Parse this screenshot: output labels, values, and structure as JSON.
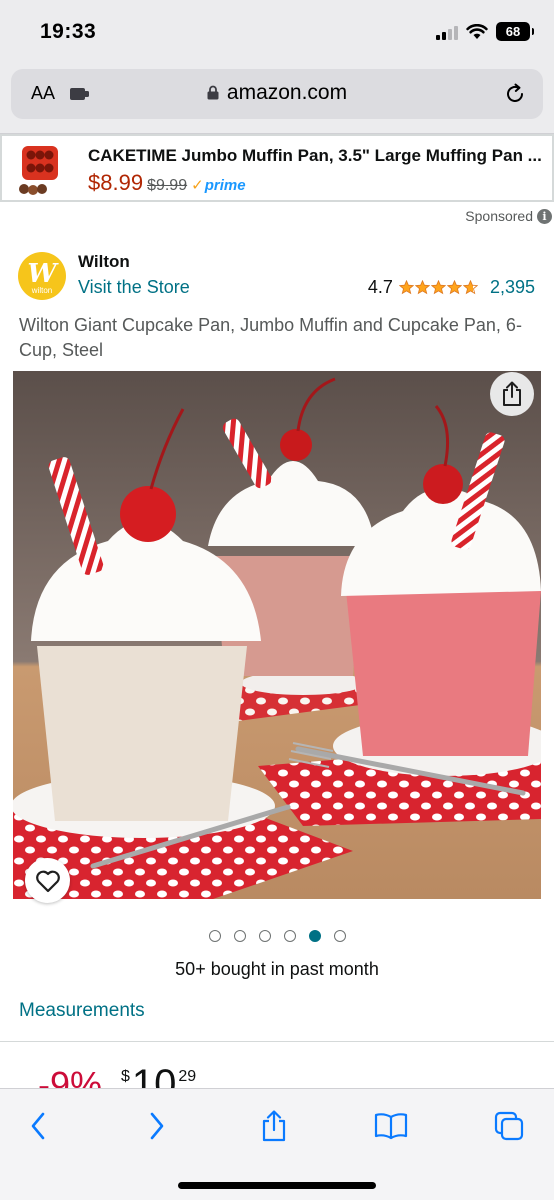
{
  "status_bar": {
    "time": "19:33",
    "battery": "68"
  },
  "browser": {
    "text_size_label": "AA",
    "url": "amazon.com"
  },
  "ad": {
    "title": "CAKETIME Jumbo Muffin Pan, 3.5\" Large Muffing Pan ...",
    "price": "$8.99",
    "old_price": "$9.99",
    "prime_label": "prime",
    "sponsored_label": "Sponsored"
  },
  "brand": {
    "name": "Wilton",
    "logo_text": "wilton",
    "visit_store": "Visit the Store",
    "rating": "4.7",
    "rating_stars": 4.7,
    "review_count": "2,395"
  },
  "product": {
    "title": "Wilton Giant Cupcake Pan, Jumbo Muffin and Cupcake Pan, 6-Cup, Steel",
    "bought_text": "50+ bought in past month",
    "measurements_link": "Measurements",
    "image_count": 6,
    "active_image": 5,
    "discount": "-9%",
    "price_currency": "$",
    "price_whole": "10",
    "price_fraction": "29"
  },
  "colors": {
    "link": "#007185",
    "price_red": "#b12704",
    "discount_red": "#cc0c39",
    "star": "#ffa41c",
    "prime_blue": "#1a98ff"
  },
  "icons": {
    "share": "share-icon",
    "heart": "heart-icon",
    "back": "chevron-left-icon",
    "forward": "chevron-right-icon",
    "bookmarks": "book-icon",
    "tabs": "tabs-icon"
  }
}
